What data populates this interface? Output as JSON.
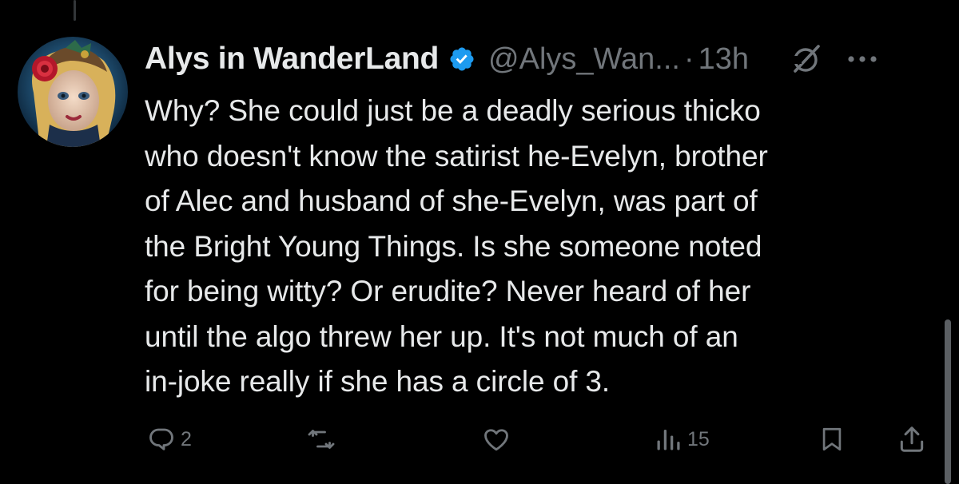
{
  "post": {
    "author_name": "Alys in WanderLand",
    "handle": "@Alys_Wan...",
    "separator": "·",
    "timestamp": "13h",
    "text": "Why? She could just be a deadly serious thicko\nwho doesn't know the satirist he-Evelyn, brother\nof Alec and husband of she-Evelyn, was part of\nthe Bright Young Things. Is she someone noted\nfor being witty? Or erudite? Never heard of her\nuntil the algo threw her up. It's not much of an\nin-joke really if she has a circle of 3."
  },
  "actions": {
    "reply_count": "2",
    "repost_count": "",
    "like_count": "",
    "views_count": "15"
  },
  "icons": {
    "verified": "verified-badge-icon",
    "grok": "grok-icon",
    "more": "more-icon",
    "reply": "reply-icon",
    "repost": "repost-icon",
    "like": "like-icon",
    "views": "views-icon",
    "bookmark": "bookmark-icon",
    "share": "share-icon"
  },
  "colors": {
    "background": "#000000",
    "text": "#e7e9ea",
    "muted": "#71767b",
    "verified_blue": "#1d9bf0"
  }
}
